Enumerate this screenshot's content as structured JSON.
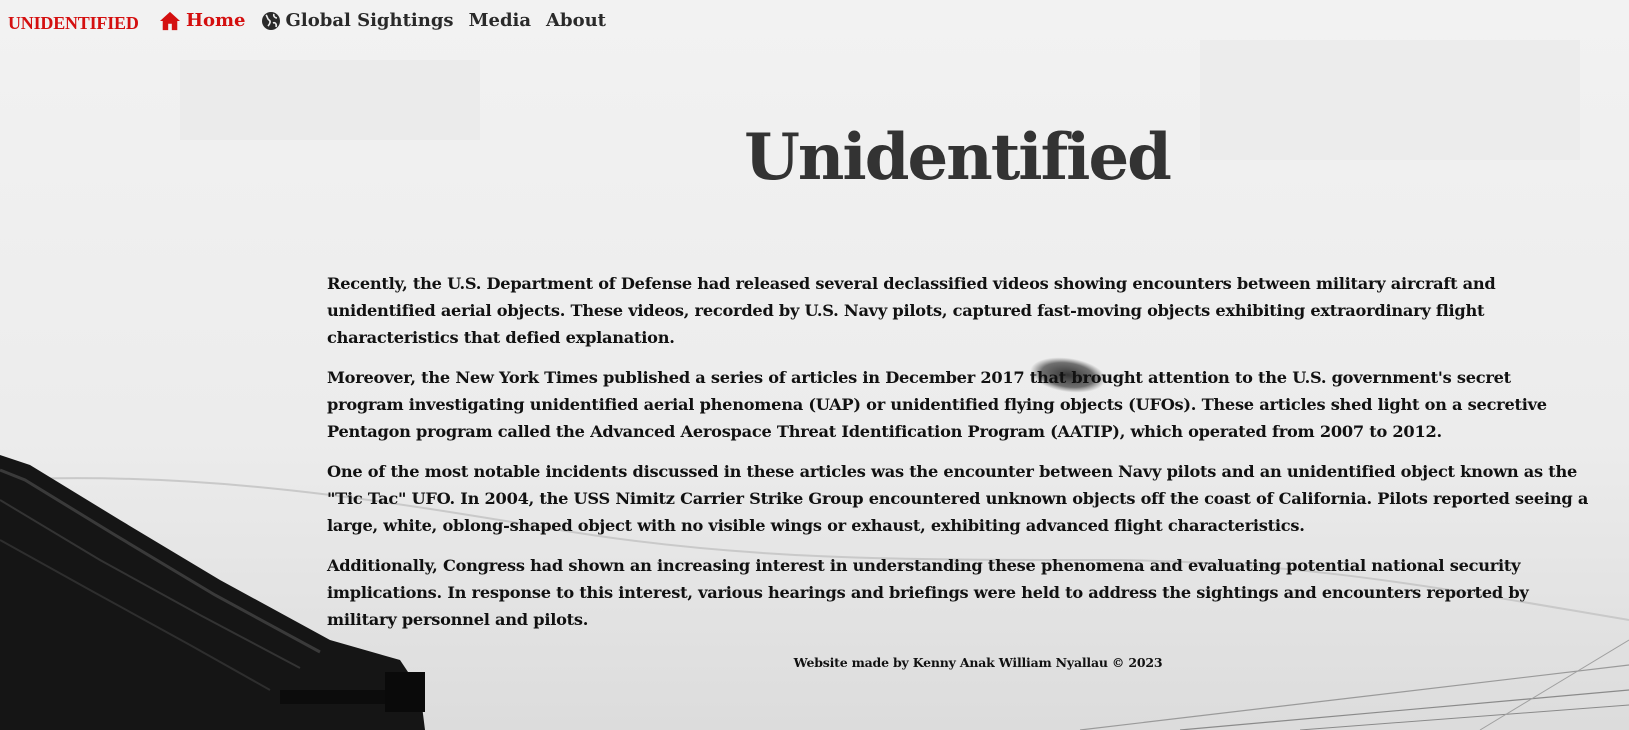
{
  "nav": {
    "brand": "UNIDENTIFIED",
    "links": [
      {
        "label": "Home",
        "icon": "home-icon",
        "active": true
      },
      {
        "label": "Global Sightings",
        "icon": "globe-icon",
        "active": false
      },
      {
        "label": "Media",
        "icon": "",
        "active": false
      },
      {
        "label": "About",
        "icon": "",
        "active": false
      }
    ]
  },
  "hero": {
    "title": "Unidentified"
  },
  "article": {
    "paragraphs": [
      "Recently, the U.S. Department of Defense had released several declassified videos showing encounters between military aircraft and unidentified aerial objects. These videos, recorded by U.S. Navy pilots, captured fast-moving objects exhibiting extraordinary flight characteristics that defied explanation.",
      "Moreover, the New York Times published a series of articles in December 2017 that brought attention to the U.S. government's secret program investigating unidentified aerial phenomena (UAP) or unidentified flying objects (UFOs). These articles shed light on a secretive Pentagon program called the Advanced Aerospace Threat Identification Program (AATIP), which operated from 2007 to 2012.",
      "One of the most notable incidents discussed in these articles was the encounter between Navy pilots and an unidentified object known as the \"Tic Tac\" UFO. In 2004, the USS Nimitz Carrier Strike Group encountered unknown objects off the coast of California. Pilots reported seeing a large, white, oblong-shaped object with no visible wings or exhaust, exhibiting advanced flight characteristics.",
      "Additionally, Congress had shown an increasing interest in understanding these phenomena and evaluating potential national security implications. In response to this interest, various hearings and briefings were held to address the sightings and encounters reported by military personnel and pilots."
    ]
  },
  "footer": {
    "text": "Website made by Kenny Anak William Nyallau © 2023"
  },
  "colors": {
    "accent": "#d40f0f",
    "text": "#111111",
    "title": "#333333"
  }
}
